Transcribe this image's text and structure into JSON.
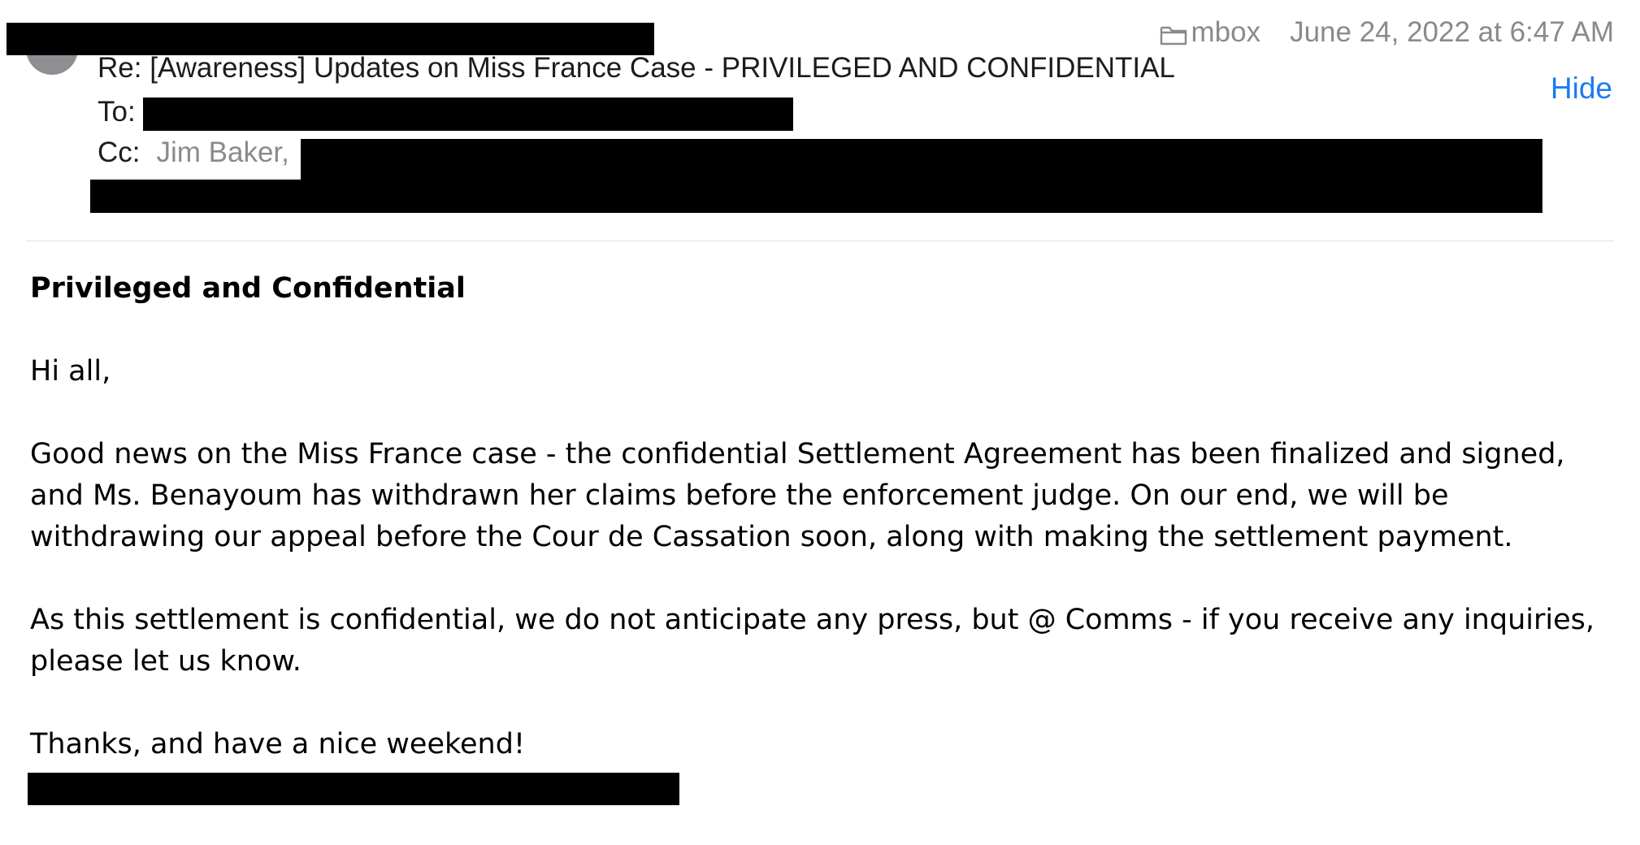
{
  "header": {
    "mailbox": "mbox",
    "date": "June 24, 2022 at 6:47 AM",
    "subject": "Re: [Awareness] Updates on Miss France Case - PRIVILEGED AND CONFIDENTIAL",
    "hide_label": "Hide",
    "to_label": "To:",
    "cc_label": "Cc:",
    "cc_visible_name": "Jim Baker,"
  },
  "body": {
    "heading": "Privileged and Confidential",
    "greeting": "Hi all,",
    "paragraph1": "Good news on the Miss France case - the confidential Settlement Agreement has been finalized and signed, and Ms. Benayoum has withdrawn her claims before the enforcement judge. On our end, we will be withdrawing our appeal before the Cour de Cassation soon, along with making the settlement payment.",
    "paragraph2": "As this settlement is confidential, we do not anticipate any press, but @ Comms - if you receive any inquiries, please let us know.",
    "closing": "Thanks, and have a nice weekend!"
  },
  "icons": {
    "mailbox_icon": "folder-icon"
  },
  "colors": {
    "link": "#1a7cf0",
    "muted": "#8a8a8e",
    "redaction": "#000000"
  }
}
